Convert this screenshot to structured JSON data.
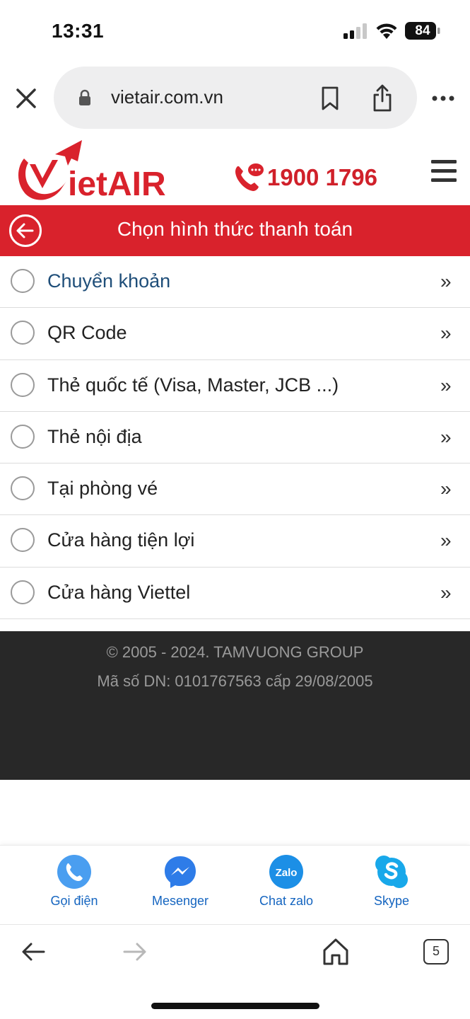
{
  "status_bar": {
    "time": "13:31",
    "battery": "84"
  },
  "browser": {
    "url": "vietair.com.vn",
    "tabs_count": "5"
  },
  "header": {
    "logo_text": "VietAIR",
    "hotline": "1900 1796"
  },
  "page": {
    "title": "Chọn hình thức thanh toán"
  },
  "payment_options": [
    {
      "label": "Chuyển khoản",
      "active": true
    },
    {
      "label": "QR Code",
      "active": false
    },
    {
      "label": "Thẻ quốc tế (Visa, Master, JCB ...)",
      "active": false
    },
    {
      "label": "Thẻ nội địa",
      "active": false
    },
    {
      "label": "Tại phòng vé",
      "active": false
    },
    {
      "label": "Cửa hàng tiện lợi",
      "active": false
    },
    {
      "label": "Cửa hàng Viettel",
      "active": false
    }
  ],
  "chevron_glyph": "»",
  "footer": {
    "copyright": "© 2005 - 2024. TAMVUONG GROUP",
    "registration": "Mã số DN: 0101767563 cấp 29/08/2005"
  },
  "contacts": [
    {
      "label": "Gọi điện",
      "icon": "phone-icon"
    },
    {
      "label": "Mesenger",
      "icon": "messenger-icon"
    },
    {
      "label": "Chat zalo",
      "icon": "zalo-icon"
    },
    {
      "label": "Skype",
      "icon": "skype-icon"
    }
  ],
  "colors": {
    "brand_red": "#d9222c",
    "link_blue": "#1565c0",
    "active_text": "#1f4e79",
    "footer_bg": "#282828"
  }
}
